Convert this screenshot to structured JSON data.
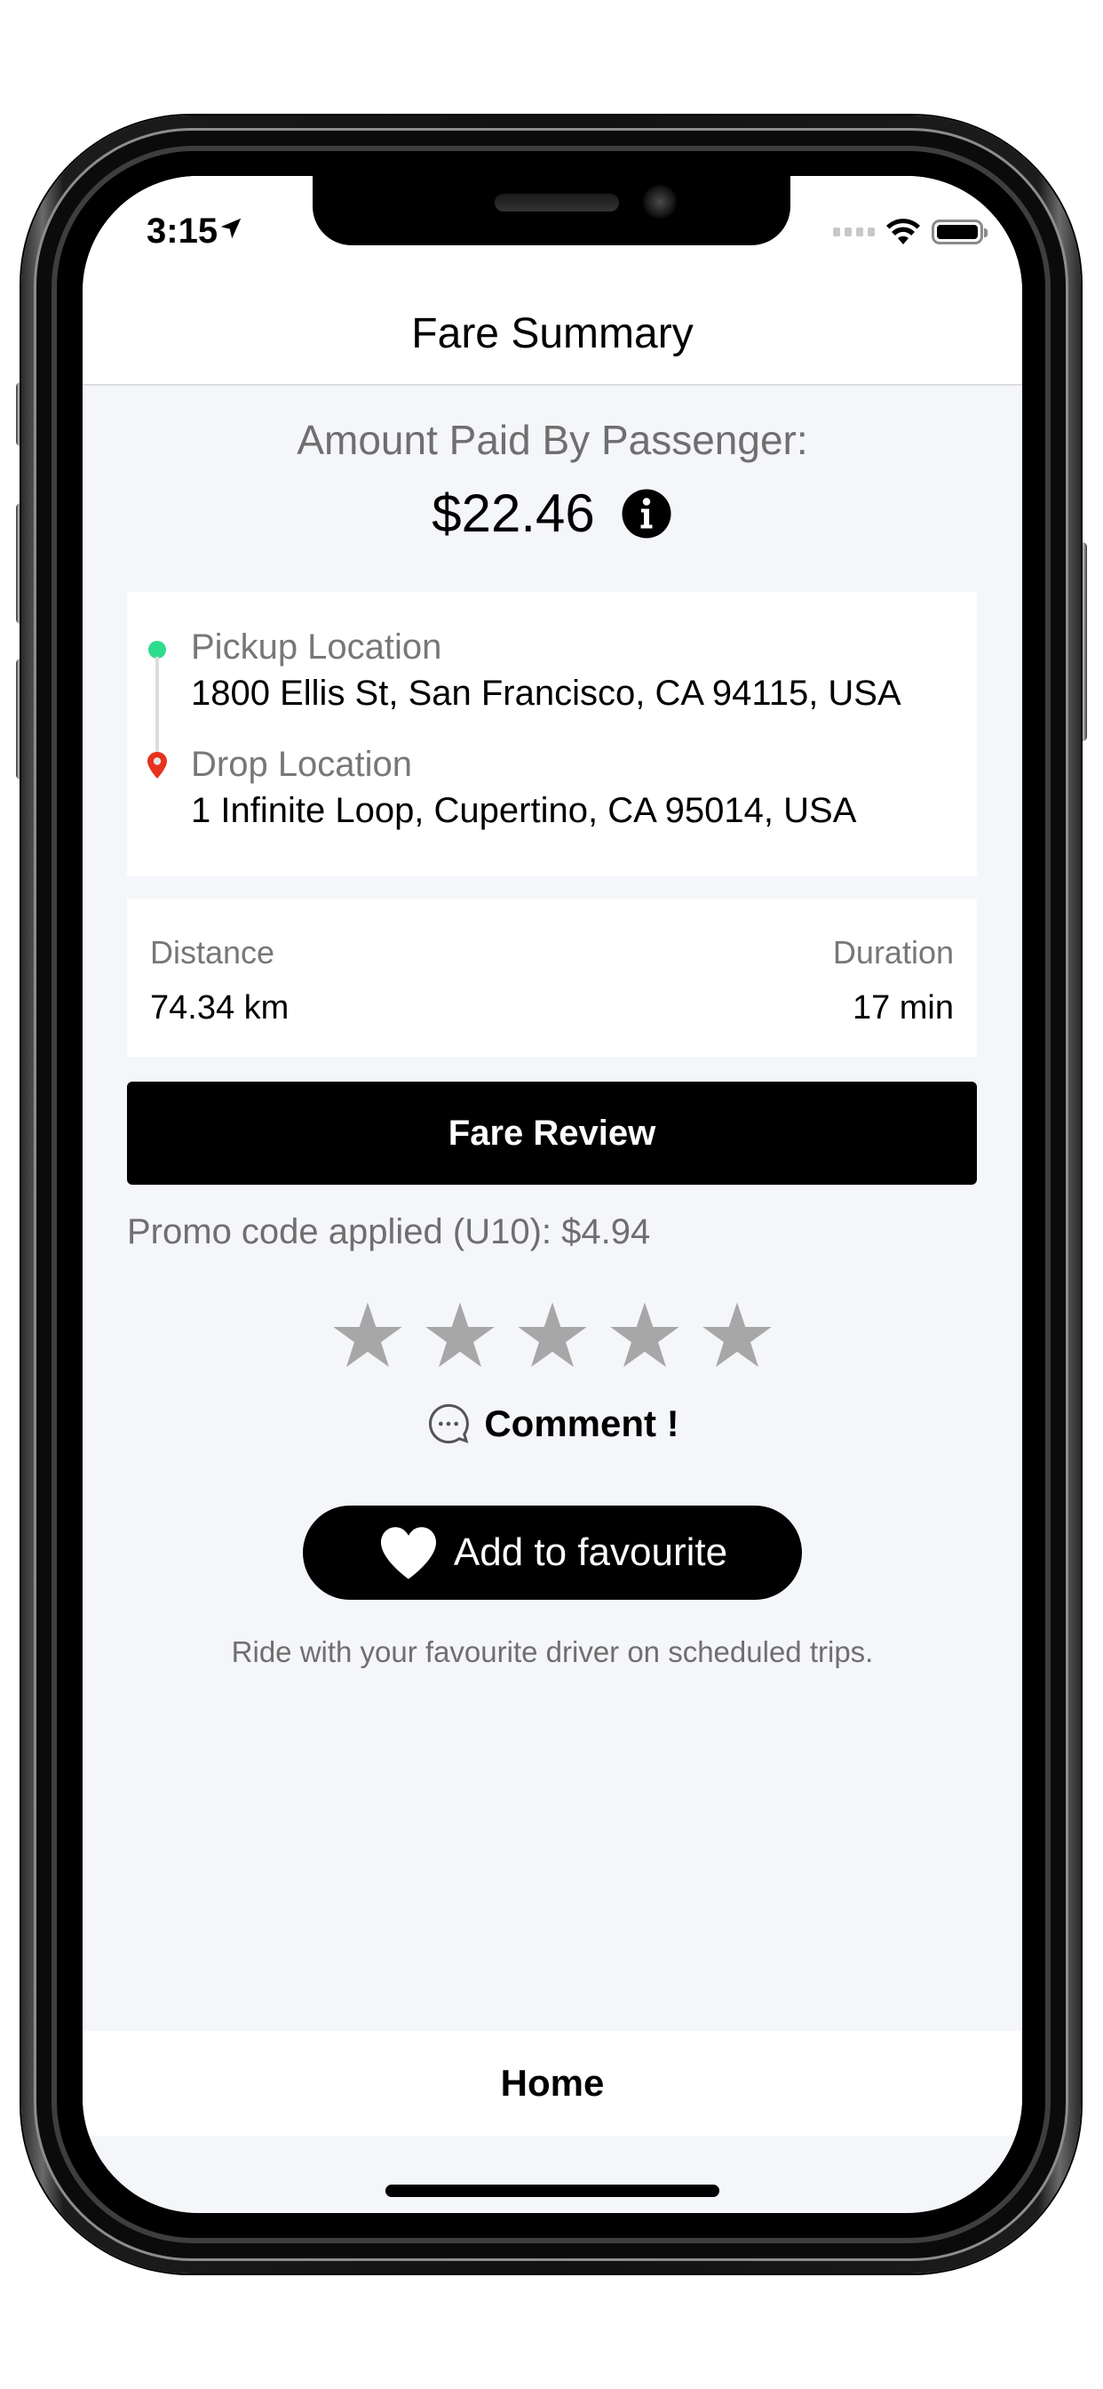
{
  "status_bar": {
    "time": "3:15",
    "location_icon": "location-arrow-icon",
    "signal_icon": "cellular-signal-icon",
    "wifi_icon": "wifi-icon",
    "battery_icon": "battery-icon",
    "battery_level": 1.0
  },
  "nav": {
    "title": "Fare Summary"
  },
  "amount": {
    "label": "Amount Paid By Passenger:",
    "value": "$22.46",
    "info_icon": "info-circle-icon"
  },
  "locations": {
    "pickup": {
      "label": "Pickup Location",
      "address": "1800 Ellis St, San Francisco, CA 94115, USA",
      "marker_color": "#2fdc8c"
    },
    "drop": {
      "label": "Drop Location",
      "address": "1 Infinite Loop, Cupertino, CA 95014, USA",
      "marker_color": "#e8321e"
    }
  },
  "trip": {
    "distance_label": "Distance",
    "distance_value": "74.34 km",
    "duration_label": "Duration",
    "duration_value": "17 min"
  },
  "fare_review_button": "Fare Review",
  "promo": "Promo code applied  (U10): $4.94",
  "rating": {
    "max": 5,
    "value": 0,
    "star_color": "#a7a7a7"
  },
  "comment": {
    "label": "Comment !",
    "icon": "chat-bubble-icon"
  },
  "favourite": {
    "button_label": "Add to favourite",
    "icon": "heart-icon",
    "subtitle": "Ride with your favourite driver on scheduled trips."
  },
  "bottom": {
    "home_label": "Home"
  },
  "colors": {
    "background": "#f5f6fa",
    "card": "#ffffff",
    "primary": "#000000",
    "muted_text": "#6f6f6f"
  }
}
